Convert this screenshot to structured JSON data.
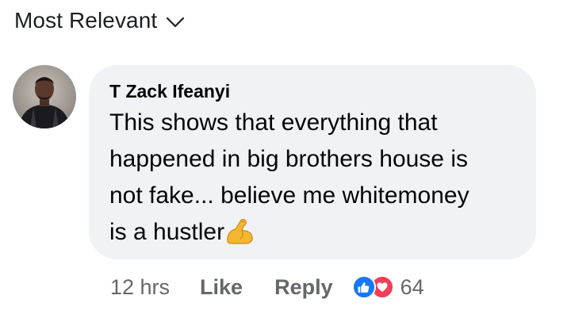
{
  "sort": {
    "label": "Most Relevant",
    "icon": "chevron-down-icon"
  },
  "comment": {
    "author": "T Zack Ifeanyi",
    "text_lines": [
      "This shows that everything that",
      "happened in big brothers house is",
      "not fake... believe me whitemoney",
      "is a hustler"
    ],
    "emoji": "flexed-biceps-icon",
    "time": "12 hrs",
    "like_label": "Like",
    "reply_label": "Reply",
    "reactions": [
      "like-reaction-icon",
      "love-reaction-icon"
    ],
    "reaction_count": "64"
  },
  "colors": {
    "bubble": "#f0f2f5",
    "meta_text": "#65676b",
    "like_blue": "#1877f2",
    "love_red": "#f33e58"
  }
}
